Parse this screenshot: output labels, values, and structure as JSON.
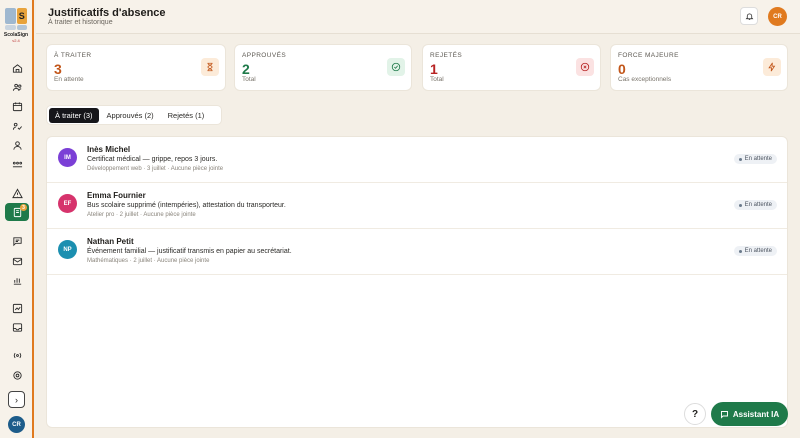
{
  "app": {
    "name": "ScolaSign",
    "version": "v2.4",
    "logo_letter": "S",
    "user_initials": "CR"
  },
  "header": {
    "title": "Justificatifs d'absence",
    "subtitle": "À traiter et historique"
  },
  "stats": [
    {
      "label": "À TRAITER",
      "value": "3",
      "sub": "En attente",
      "color": "#c2561a",
      "icon": "hourglass-icon"
    },
    {
      "label": "APPROUVÉS",
      "value": "2",
      "sub": "Total",
      "color": "#1f7a4a",
      "icon": "check-circle-icon"
    },
    {
      "label": "REJETÉS",
      "value": "1",
      "sub": "Total",
      "color": "#b82424",
      "icon": "x-circle-icon"
    },
    {
      "label": "FORCE MAJEURE",
      "value": "0",
      "sub": "Cas exceptionnels",
      "color": "#c2561a",
      "icon": "bolt-icon"
    }
  ],
  "tabs": [
    {
      "label": "À traiter (3)",
      "active": true
    },
    {
      "label": "Approuvés (2)",
      "active": false
    },
    {
      "label": "Rejetés (1)",
      "active": false
    }
  ],
  "requests": [
    {
      "initials": "IM",
      "name": "Inès Michel",
      "desc": "Certificat médical — grippe, repos 3 jours.",
      "meta": "Développement web · 3 juillet · Aucune pièce jointe",
      "status": "En attente",
      "color": "#7b3fd6"
    },
    {
      "initials": "EF",
      "name": "Emma Fournier",
      "desc": "Bus scolaire supprimé (intempéries), attestation du transporteur.",
      "meta": "Atelier pro · 2 juillet · Aucune pièce jointe",
      "status": "En attente",
      "color": "#d6336c"
    },
    {
      "initials": "NP",
      "name": "Nathan Petit",
      "desc": "Événement familial — justificatif transmis en papier au secrétariat.",
      "meta": "Mathématiques · 2 juillet · Aucune pièce jointe",
      "status": "En attente",
      "color": "#1b8fb0"
    }
  ],
  "sidebar": {
    "active_badge": "3"
  },
  "actions": {
    "help_label": "?",
    "ai_label": "Assistant IA"
  },
  "colors": {
    "accent": "#e07a1f",
    "primary_green": "#1f7a4a"
  }
}
